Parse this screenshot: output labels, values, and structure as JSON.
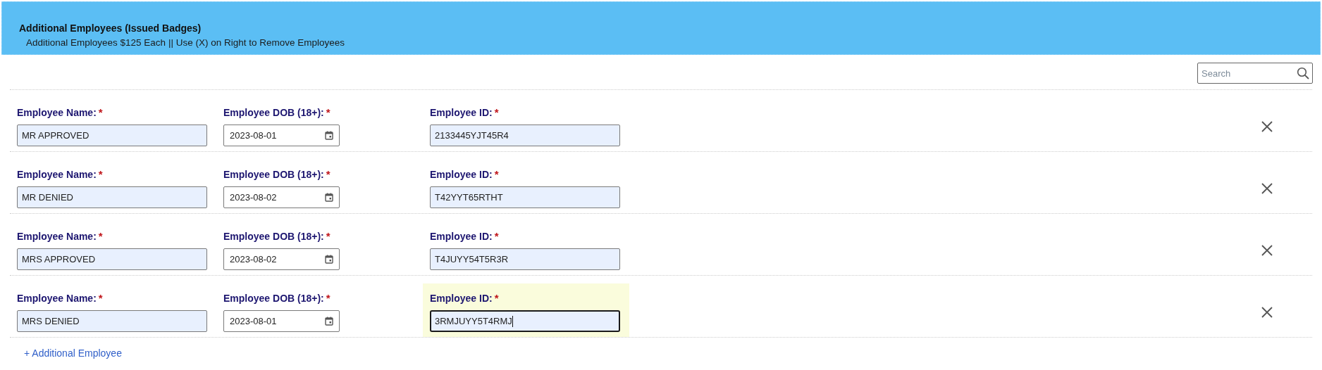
{
  "header": {
    "title": "Additional Employees (Issued Badges)",
    "subtitle": "Additional Employees $125 Each || Use (X) on Right to Remove Employees"
  },
  "search": {
    "placeholder": "Search"
  },
  "employees": [
    {
      "fields": [
        {
          "kind": "text",
          "label": "Employee Name:",
          "required": "*",
          "value": "MR APPROVED",
          "focused": false
        },
        {
          "kind": "date",
          "label": "Employee DOB (18+):",
          "required": "*",
          "value": "2023-08-01",
          "focused": false
        },
        {
          "kind": "text",
          "label": "Employee ID:",
          "required": "*",
          "value": "2133445YJT45R4",
          "focused": false
        }
      ]
    },
    {
      "fields": [
        {
          "kind": "text",
          "label": "Employee Name:",
          "required": "*",
          "value": "MR DENIED",
          "focused": false
        },
        {
          "kind": "date",
          "label": "Employee DOB (18+):",
          "required": "*",
          "value": "2023-08-02",
          "focused": false
        },
        {
          "kind": "text",
          "label": "Employee ID:",
          "required": "*",
          "value": "T42YYT65RTHT",
          "focused": false
        }
      ]
    },
    {
      "fields": [
        {
          "kind": "text",
          "label": "Employee Name:",
          "required": "*",
          "value": "MRS APPROVED",
          "focused": false
        },
        {
          "kind": "date",
          "label": "Employee DOB (18+):",
          "required": "*",
          "value": "2023-08-02",
          "focused": false
        },
        {
          "kind": "text",
          "label": "Employee ID:",
          "required": "*",
          "value": "T4JUYY54T5R3R",
          "focused": false
        }
      ]
    },
    {
      "fields": [
        {
          "kind": "text",
          "label": "Employee Name:",
          "required": "*",
          "value": "MRS DENIED",
          "focused": false
        },
        {
          "kind": "date",
          "label": "Employee DOB (18+):",
          "required": "*",
          "value": "2023-08-01",
          "focused": false
        },
        {
          "kind": "text",
          "label": "Employee ID:",
          "required": "*",
          "value": "3RMJUYY5T4RMJ",
          "focused": true
        }
      ]
    }
  ],
  "add_link": "+ Additional Employee"
}
